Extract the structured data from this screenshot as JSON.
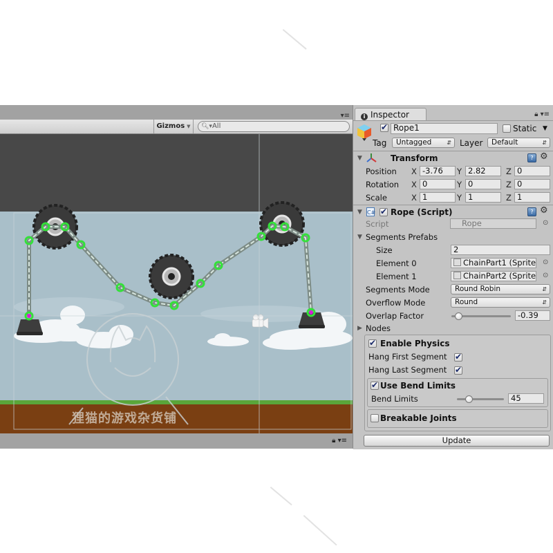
{
  "scene": {
    "gizmos_label": "Gizmos",
    "search_placeholder": "All",
    "menu_icon": "▾≡",
    "lock_icon": "🔒",
    "watermark_text": "狸猫的游戏杂货铺",
    "colors": {
      "sky": "#a9bfc9",
      "ground": "#7a3f12",
      "grass": "#5aa63a",
      "chain_node": "#34e03a",
      "anchor_node": "#d61fd6",
      "top_band": "#484848"
    }
  },
  "inspector": {
    "tab_label": "Inspector",
    "object_name": "Rope1",
    "active": true,
    "static_label": "Static",
    "static_checked": false,
    "tag_label": "Tag",
    "tag_value": "Untagged",
    "layer_label": "Layer",
    "layer_value": "Default",
    "transform": {
      "title": "Transform",
      "rows": [
        {
          "label": "Position",
          "x": "-3.76",
          "y": "2.82",
          "z": "0"
        },
        {
          "label": "Rotation",
          "x": "0",
          "y": "0",
          "z": "0"
        },
        {
          "label": "Scale",
          "x": "1",
          "y": "1",
          "z": "1"
        }
      ],
      "axis_labels": [
        "X",
        "Y",
        "Z"
      ]
    },
    "rope_script": {
      "title": "Rope (Script)",
      "enabled": true,
      "script_label": "Script",
      "script_value": "Rope",
      "segments_prefabs_label": "Segments Prefabs",
      "size_label": "Size",
      "size_value": "2",
      "elements": [
        {
          "label": "Element 0",
          "value": "ChainPart1 (Sprite"
        },
        {
          "label": "Element 1",
          "value": "ChainPart2 (Sprite"
        }
      ],
      "segments_mode_label": "Segments Mode",
      "segments_mode_value": "Round Robin",
      "overflow_mode_label": "Overflow Mode",
      "overflow_mode_value": "Round",
      "overlap_factor_label": "Overlap Factor",
      "overlap_factor_value": "-0.39",
      "overlap_factor_slider_fraction": 0.12,
      "nodes_label": "Nodes",
      "enable_physics_label": "Enable Physics",
      "enable_physics_checked": true,
      "hang_first_label": "Hang First Segment",
      "hang_first_checked": true,
      "hang_last_label": "Hang Last Segment",
      "hang_last_checked": true,
      "use_bend_limits_label": "Use Bend Limits",
      "use_bend_limits_checked": true,
      "bend_limits_label": "Bend Limits",
      "bend_limits_value": "45",
      "bend_limits_slider_fraction": 0.25,
      "breakable_joints_label": "Breakable Joints",
      "breakable_joints_checked": false,
      "update_label": "Update"
    }
  }
}
